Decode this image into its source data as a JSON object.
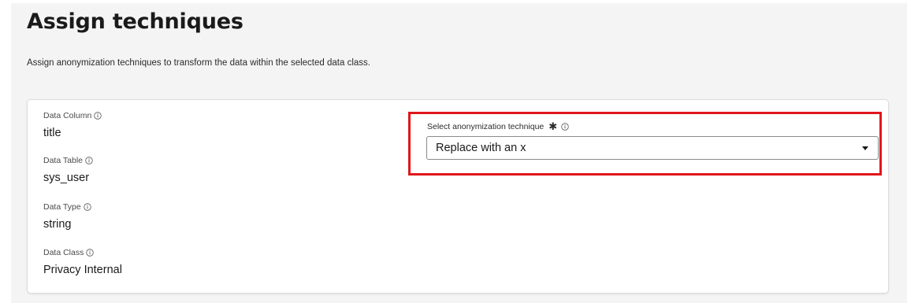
{
  "page": {
    "title": "Assign techniques",
    "description": "Assign anonymization techniques to transform the data within the selected data class."
  },
  "fields": [
    {
      "label": "Data Column",
      "value": "title"
    },
    {
      "label": "Data Table",
      "value": "sys_user"
    },
    {
      "label": "Data Type",
      "value": "string"
    },
    {
      "label": "Data Class",
      "value": "Privacy Internal"
    }
  ],
  "technique": {
    "label": "Select anonymization technique",
    "selected": "Replace with an x"
  },
  "icons": {
    "info": "info-icon",
    "required": "required-asterisk-icon",
    "dropdown": "chevron-down-icon"
  },
  "colors": {
    "highlight": "#e0171b",
    "page_background": "#f4f4f4"
  }
}
